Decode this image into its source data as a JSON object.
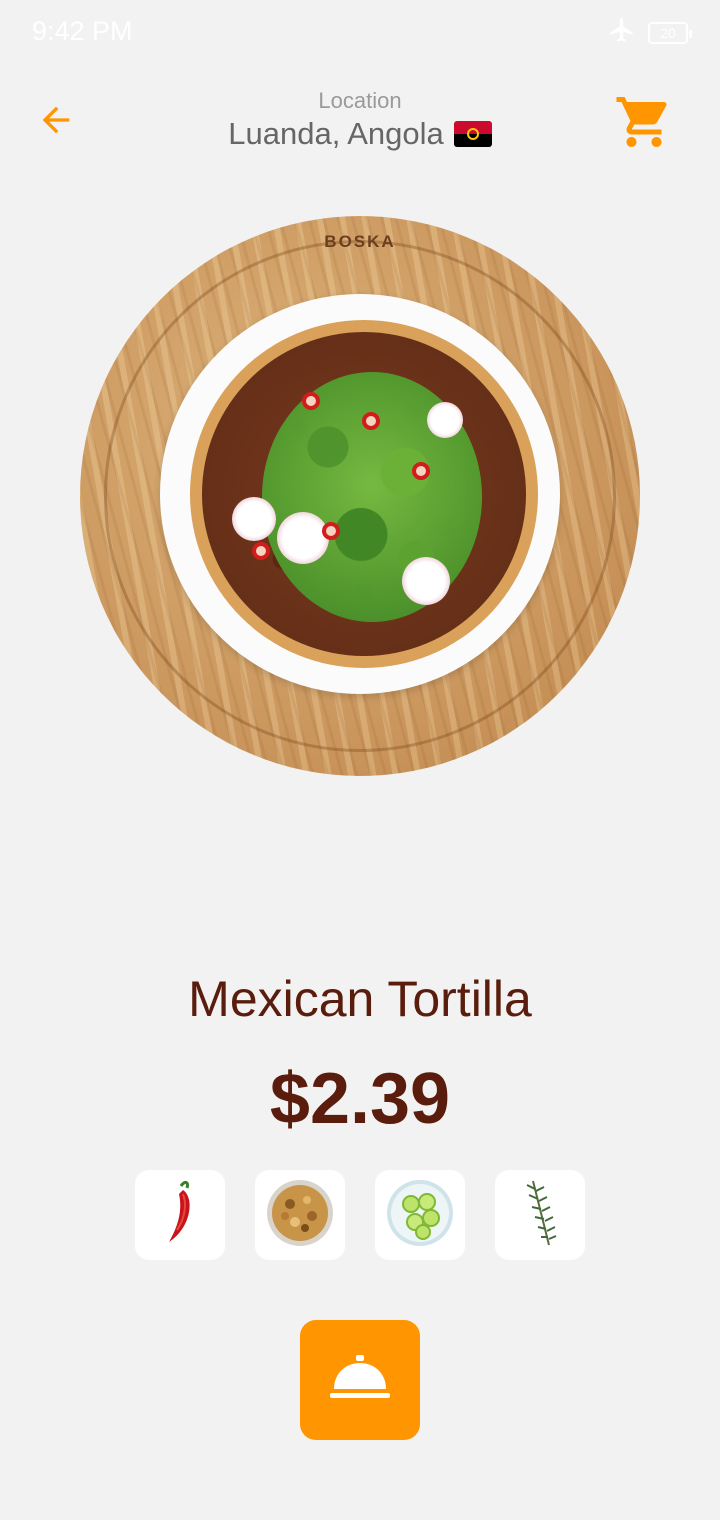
{
  "status_bar": {
    "time": "9:42 PM",
    "battery": "20",
    "icons": [
      "airplane-mode-icon",
      "battery-icon"
    ]
  },
  "header": {
    "location_label": "Location",
    "location_value": "Luanda, Angola",
    "flag": "angola-flag",
    "back_icon": "arrow-left-icon",
    "cart_icon": "cart-icon"
  },
  "product": {
    "image": "mexican-tortilla-pizza",
    "brand_mark": "BOSKA",
    "name": "Mexican Tortilla",
    "price": "$2.39",
    "ingredients": [
      {
        "name": "chili-pepper",
        "icon": "chili-pepper-icon"
      },
      {
        "name": "mixed-nuts",
        "icon": "nuts-bowl-icon"
      },
      {
        "name": "lime-slices",
        "icon": "lime-bowl-icon"
      },
      {
        "name": "rosemary",
        "icon": "rosemary-icon"
      }
    ]
  },
  "actions": {
    "order_icon": "service-bell-icon"
  },
  "colors": {
    "accent": "#ff9500",
    "title": "#5a1d0d",
    "background": "#f2f2f2",
    "location_label": "#9a9a9a",
    "location_value": "#666666"
  }
}
